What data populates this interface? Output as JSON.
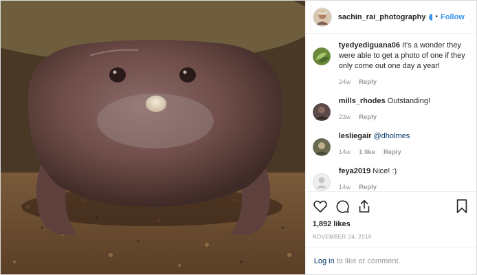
{
  "post": {
    "author": "sachin_rai_photography",
    "follow_label": "Follow",
    "separator": "•",
    "image_alt": "purple frog photo"
  },
  "comments": [
    {
      "user": "tyedyediguana06",
      "text": "It's a wonder they were able to get a photo of one if they only come out one day a year!",
      "time": "24w",
      "likes": "",
      "reply": "Reply",
      "avatar": "green-leaves-avatar"
    },
    {
      "user": "mills_rhodes",
      "text": "Outstanding!",
      "time": "23w",
      "likes": "",
      "reply": "Reply",
      "avatar": "photo-avatar"
    },
    {
      "user": "lesliegair",
      "text": "@dholmes",
      "time": "14w",
      "likes": "1 like",
      "reply": "Reply",
      "avatar": "photo-avatar"
    },
    {
      "user": "feya2019",
      "text": "Nice! :)",
      "time": "14w",
      "likes": "",
      "reply": "Reply",
      "avatar": "default-avatar"
    }
  ],
  "actions": {
    "likes": "1,892 likes",
    "date": "NOVEMBER 24, 2018"
  },
  "login": {
    "link": "Log in",
    "text": "to like or comment."
  },
  "colors": {
    "link": "#3897f0",
    "text": "#262626",
    "muted": "#999999"
  }
}
